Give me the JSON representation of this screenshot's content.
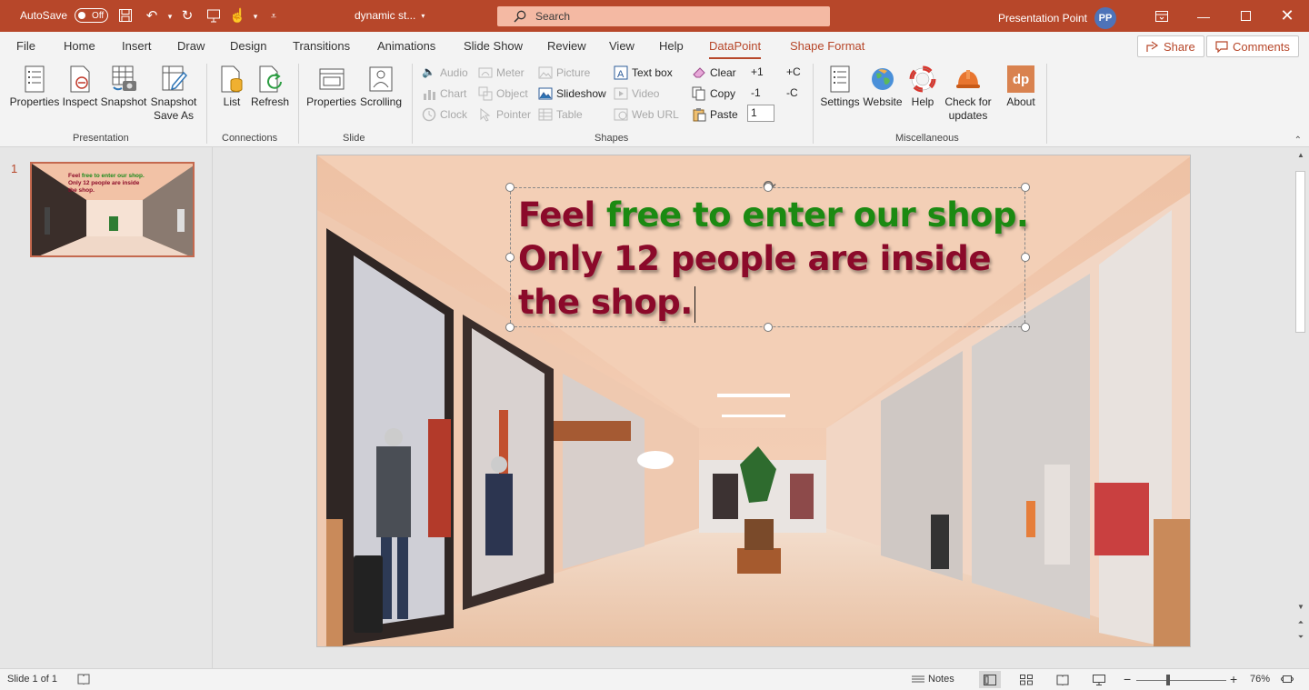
{
  "titlebar": {
    "autosave_label": "AutoSave",
    "autosave_state": "Off",
    "document_name": "dynamic st...",
    "search_placeholder": "Search",
    "user_name": "Presentation Point",
    "user_initials": "PP"
  },
  "tabs": [
    "File",
    "Home",
    "Insert",
    "Draw",
    "Design",
    "Transitions",
    "Animations",
    "Slide Show",
    "Review",
    "View",
    "Help",
    "DataPoint",
    "Shape Format"
  ],
  "active_tab": "DataPoint",
  "share_label": "Share",
  "comments_label": "Comments",
  "ribbon": {
    "presentation": {
      "group_label": "Presentation",
      "properties": "Properties",
      "inspect": "Inspect",
      "snapshot": "Snapshot",
      "snapshot_save_as_line1": "Snapshot",
      "snapshot_save_as_line2": "Save As"
    },
    "connections": {
      "group_label": "Connections",
      "list": "List",
      "refresh": "Refresh"
    },
    "slide": {
      "group_label": "Slide",
      "properties": "Properties",
      "scrolling": "Scrolling"
    },
    "shapes": {
      "group_label": "Shapes",
      "audio": "Audio",
      "chart": "Chart",
      "clock": "Clock",
      "meter": "Meter",
      "object": "Object",
      "pointer": "Pointer",
      "picture": "Picture",
      "slideshow": "Slideshow",
      "table": "Table",
      "text_box": "Text box",
      "video": "Video",
      "web_url": "Web URL",
      "clear": "Clear",
      "copy": "Copy",
      "paste": "Paste",
      "plus1": "+1",
      "minus1": "-1",
      "plusC": "+C",
      "minusC": "-C",
      "counter_value": "1"
    },
    "misc": {
      "group_label": "Miscellaneous",
      "settings": "Settings",
      "website": "Website",
      "help": "Help",
      "check_line1": "Check for",
      "check_line2": "updates",
      "about": "About",
      "about_logo": "dp"
    }
  },
  "slides_pane": {
    "slide_number": "1",
    "thumb_line1_a": "Feel ",
    "thumb_line1_b": "free to enter our shop.",
    "thumb_line2": "Only 12 people are inside",
    "thumb_line3": "the shop."
  },
  "slide": {
    "line1_a": "Feel ",
    "line1_b": "free to enter our shop.",
    "line2": "Only 12 people are inside",
    "line3": "the shop."
  },
  "statusbar": {
    "slide_info": "Slide 1 of 1",
    "notes": "Notes",
    "zoom": "76%"
  },
  "colors": {
    "accent": "#b7472a",
    "text_red": "#8b0a2a",
    "text_green": "#1b8a12"
  }
}
